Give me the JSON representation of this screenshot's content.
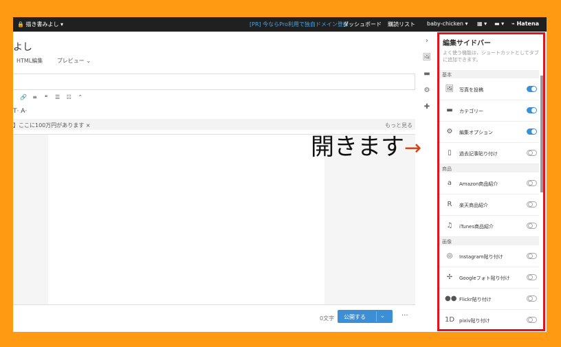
{
  "topbar": {
    "left": "🔒 描き書みよし ▾",
    "promo": "[PR] 今ならPro利用で独自ドメイン登録",
    "dashboard": "ダッシュボード",
    "reading_list": "購読リスト",
    "user": "baby-chicken ▾",
    "grid": "▦ ▾",
    "chat": "▬ ▾",
    "brand": "⌁ Hatena"
  },
  "editor": {
    "title_fragment": "よし",
    "tabs": [
      "HTML編集",
      "プレビュー ⌄"
    ],
    "toolbar_icons": [
      "🔗",
      "≡",
      "❝",
      "☰",
      "☷",
      "⌃"
    ],
    "format_row": "T· A·",
    "notice_text": "】ここに100万円があります ×",
    "notice_more": "もっと見る",
    "char_count": "0文字",
    "publish_label": "公開する",
    "publish_chevron": "⌄",
    "more_menu": "···"
  },
  "side_icons": [
    "›",
    "🖼",
    "▬",
    "⚙",
    "✚"
  ],
  "overlay": {
    "text": "開きます",
    "arrow": "→"
  },
  "sidebar": {
    "title": "編集サイドバー",
    "description": "よく使う機能は、ショートカットとしてタブに追加できます。",
    "sections": [
      {
        "label": "基本",
        "items": [
          {
            "icon": "🖼",
            "label": "写真を投稿",
            "on": true
          },
          {
            "icon": "▬",
            "label": "カテゴリー",
            "on": true
          },
          {
            "icon": "⚙",
            "label": "編集オプション",
            "on": true
          },
          {
            "icon": "▯",
            "label": "過去記事貼り付け",
            "on": false
          }
        ]
      },
      {
        "label": "商品",
        "items": [
          {
            "icon": "a",
            "label": "Amazon商品紹介",
            "on": false
          },
          {
            "icon": "R",
            "label": "楽天商品紹介",
            "on": false
          },
          {
            "icon": "♫",
            "label": "iTunes商品紹介",
            "on": false
          }
        ]
      },
      {
        "label": "画像",
        "items": [
          {
            "icon": "◎",
            "label": "Instagram貼り付け",
            "on": false
          },
          {
            "icon": "✢",
            "label": "Googleフォト貼り付け",
            "on": false
          },
          {
            "icon": "●●",
            "label": "Flickr貼り付け",
            "on": false
          },
          {
            "icon": "1D",
            "label": "pixiv貼り付け",
            "on": false
          }
        ]
      }
    ]
  },
  "colors": {
    "background": "#ff9a12",
    "highlight_border": "#e0131c",
    "accent": "#3c8ed5"
  }
}
